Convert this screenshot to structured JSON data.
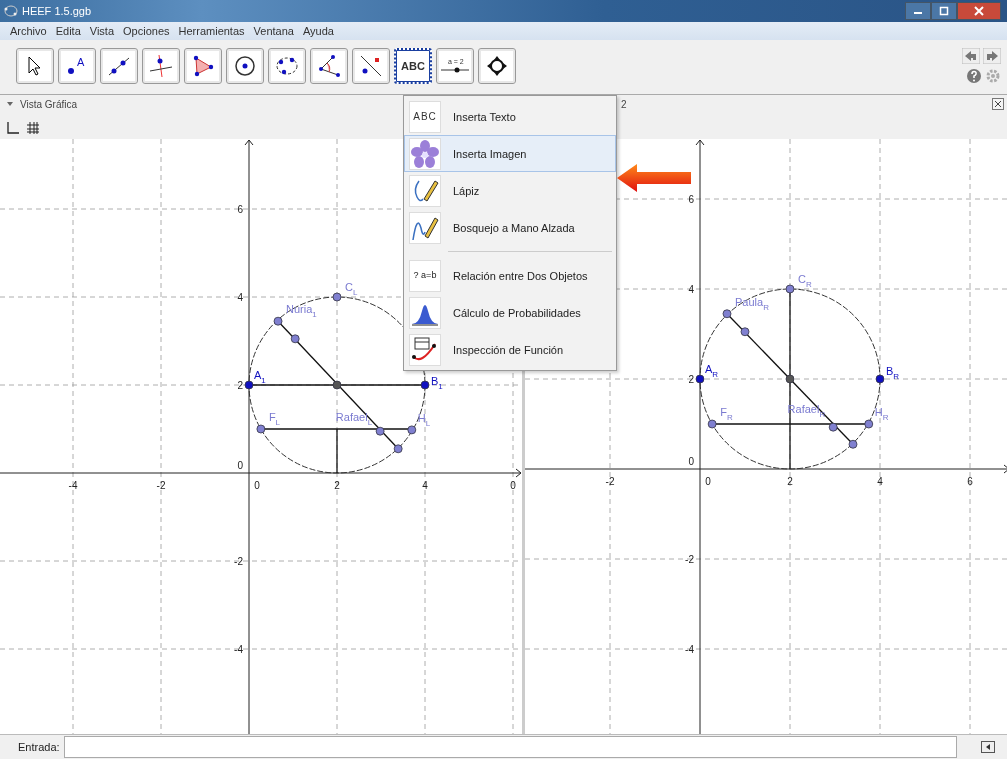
{
  "window": {
    "title": "HEEF 1.5.ggb"
  },
  "menu_bar": [
    "Archivo",
    "Edita",
    "Vista",
    "Opciones",
    "Herramientas",
    "Ventana",
    "Ayuda"
  ],
  "toolbar": [
    {
      "kind": "pointer",
      "selected": false
    },
    {
      "kind": "point",
      "selected": false,
      "icon_text": "A"
    },
    {
      "kind": "line",
      "selected": false
    },
    {
      "kind": "perpendicular",
      "selected": false
    },
    {
      "kind": "polygon",
      "selected": false
    },
    {
      "kind": "circle",
      "selected": false
    },
    {
      "kind": "conic",
      "selected": false
    },
    {
      "kind": "angle",
      "selected": false
    },
    {
      "kind": "reflect",
      "selected": false
    },
    {
      "kind": "text",
      "selected": true,
      "icon_text": "ABC"
    },
    {
      "kind": "slider",
      "selected": false,
      "icon_text": "a = 2"
    },
    {
      "kind": "move-view",
      "selected": false
    }
  ],
  "tool_menu": [
    {
      "kind": "text",
      "icon_text": "ABC",
      "label": "Inserta Texto",
      "selected": false,
      "separator_after": false
    },
    {
      "kind": "image",
      "label": "Inserta Imagen",
      "selected": true,
      "separator_after": false
    },
    {
      "kind": "pen",
      "label": "Lápiz",
      "selected": false,
      "separator_after": false
    },
    {
      "kind": "freehand",
      "label": "Bosquejo a Mano Alzada",
      "selected": false,
      "separator_after": true
    },
    {
      "kind": "relation",
      "icon_text": "? a=b",
      "label": "Relación entre Dos Objetos",
      "selected": false,
      "separator_after": false
    },
    {
      "kind": "probability",
      "label": "Cálculo de Probabilidades",
      "selected": false,
      "separator_after": false
    },
    {
      "kind": "function",
      "label": "Inspección de Función",
      "selected": false,
      "separator_after": false
    }
  ],
  "views": [
    {
      "title": "Vista Gráfica",
      "x_ticks": [
        "-4",
        "-2",
        "0",
        "2",
        "4",
        "0"
      ],
      "y_ticks": [
        "6",
        "4",
        "2",
        "0",
        "-2",
        "-4"
      ],
      "points": [
        {
          "kind": "bound",
          "label": "C",
          "sub": "L"
        },
        {
          "kind": "bound",
          "label": "Nuria",
          "sub": "1"
        },
        {
          "kind": "bound"
        },
        {
          "kind": "free",
          "label": "A",
          "sub": "1"
        },
        {
          "kind": "center"
        },
        {
          "kind": "free",
          "label": "B",
          "sub": "1"
        },
        {
          "kind": "bound",
          "label": "F",
          "sub": "L"
        },
        {
          "kind": "bound",
          "label": "Rafael",
          "sub": "L"
        },
        {
          "kind": "bound",
          "label": "H",
          "sub": "L"
        },
        {
          "kind": "bound"
        }
      ]
    },
    {
      "title": "2",
      "x_ticks": [
        "-2",
        "0",
        "2",
        "4",
        "6"
      ],
      "y_ticks": [
        "6",
        "4",
        "2",
        "0",
        "-2",
        "-4"
      ],
      "points": [
        {
          "kind": "bound",
          "label": "C",
          "sub": "R"
        },
        {
          "kind": "bound",
          "label": "Paula",
          "sub": "R"
        },
        {
          "kind": "bound"
        },
        {
          "kind": "free",
          "label": "A",
          "sub": "R"
        },
        {
          "kind": "center"
        },
        {
          "kind": "free",
          "label": "B",
          "sub": "R"
        },
        {
          "kind": "bound",
          "label": "F",
          "sub": "R"
        },
        {
          "kind": "bound",
          "label": "Rafael",
          "sub": "R"
        },
        {
          "kind": "bound",
          "label": "H",
          "sub": "R"
        },
        {
          "kind": "bound"
        }
      ]
    }
  ],
  "input_bar": {
    "label": "Entrada:"
  }
}
